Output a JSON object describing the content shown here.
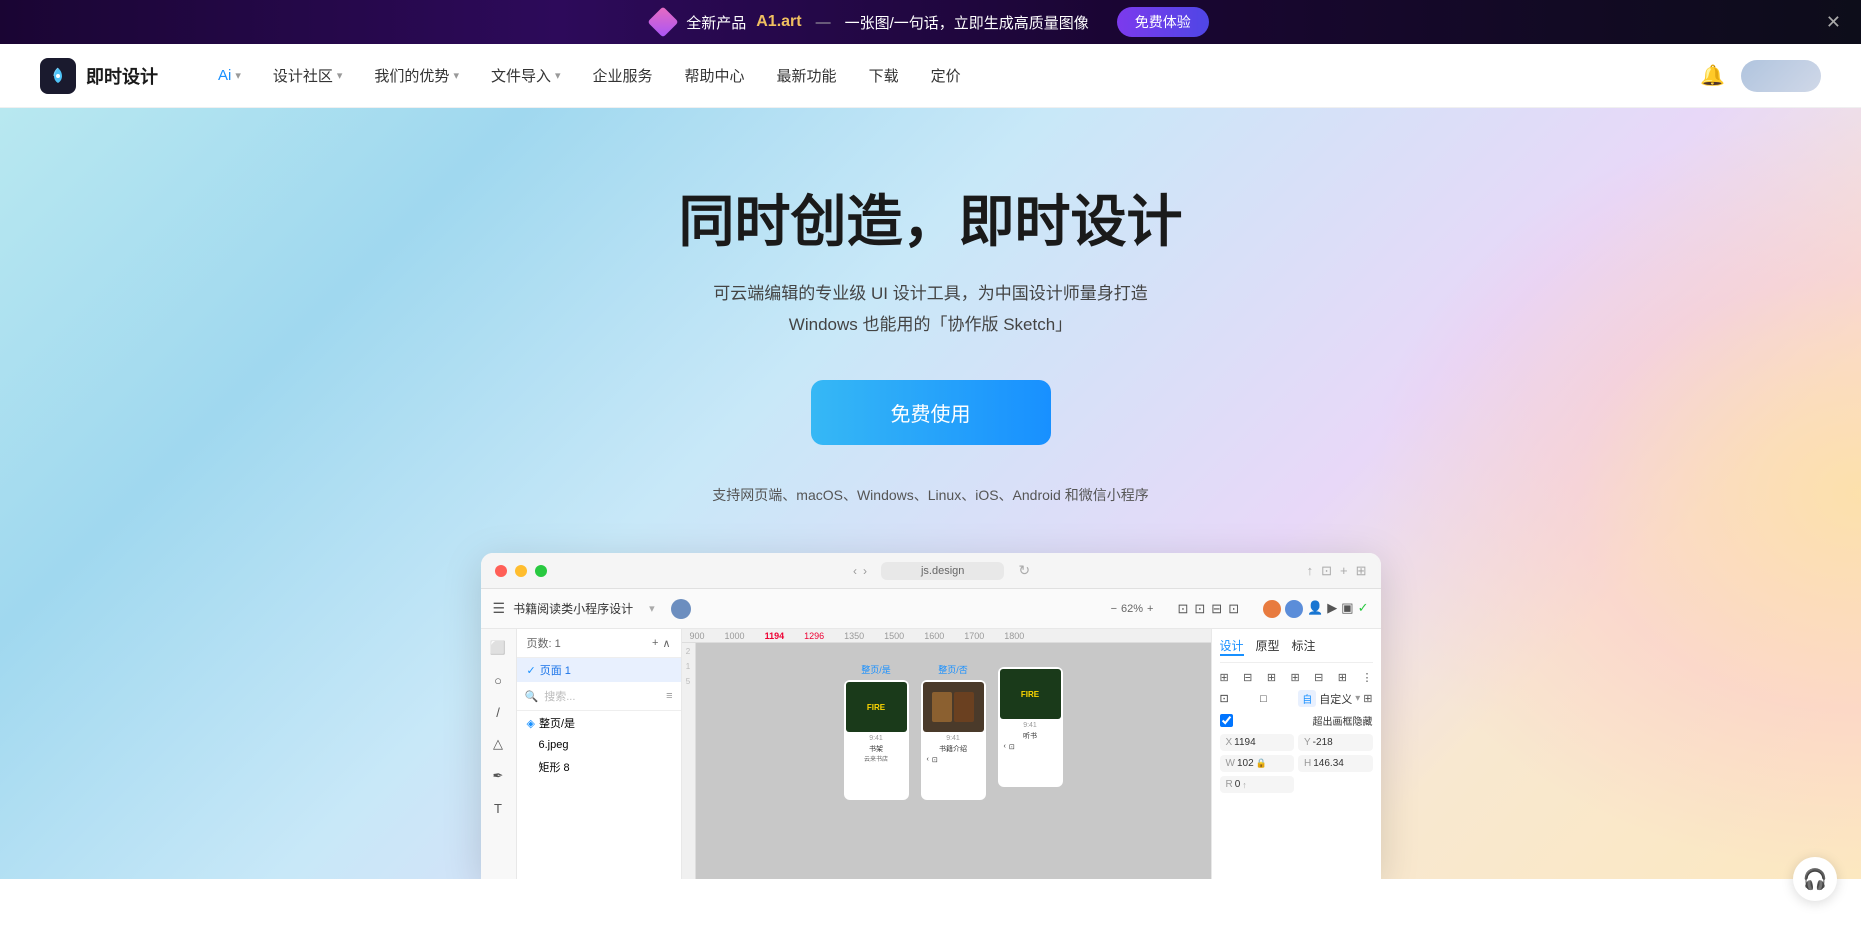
{
  "banner": {
    "diamond_label": "◆",
    "new_product": "全新产品",
    "brand": "A1.art",
    "separator": "—",
    "tagline": "一张图/一句话，立即生成高质量图像",
    "cta": "免费体验",
    "close": "✕"
  },
  "nav": {
    "logo_icon": "◈",
    "logo_text": "即时设计",
    "items": [
      {
        "label": "Ai",
        "has_dropdown": true,
        "active": true
      },
      {
        "label": "设计社区",
        "has_dropdown": true,
        "active": false
      },
      {
        "label": "我们的优势",
        "has_dropdown": true,
        "active": false
      },
      {
        "label": "文件导入",
        "has_dropdown": true,
        "active": false
      },
      {
        "label": "企业服务",
        "has_dropdown": false,
        "active": false
      },
      {
        "label": "帮助中心",
        "has_dropdown": false,
        "active": false
      },
      {
        "label": "最新功能",
        "has_dropdown": false,
        "active": false
      },
      {
        "label": "下载",
        "has_dropdown": false,
        "active": false
      },
      {
        "label": "定价",
        "has_dropdown": false,
        "active": false
      }
    ],
    "bell": "🔔"
  },
  "hero": {
    "title": "同时创造，即时设计",
    "subtitle_line1": "可云端编辑的专业级 UI 设计工具，为中国设计师量身打造",
    "subtitle_line2": "Windows 也能用的「协作版 Sketch」",
    "cta_button": "免费使用",
    "platforms": "支持网页端、macOS、Windows、Linux、iOS、Android 和微信小程序"
  },
  "app_window": {
    "title": "书籍阅读类小程序设计",
    "url": "js.design",
    "zoom": "62%",
    "pages_label": "页数: 1",
    "page_name": "页面 1",
    "canvas_rulers": [
      "900",
      "1000",
      "1194",
      "1296",
      "1350",
      "1500",
      "1600",
      "1700",
      "1800"
    ],
    "layers": [
      {
        "name": "整页/是",
        "indent": 0
      },
      {
        "name": "6.jpeg",
        "indent": 1
      },
      {
        "name": "矩形 8",
        "indent": 1
      }
    ],
    "right_panel": {
      "tabs": [
        "设计",
        "原型",
        "标注"
      ],
      "active_tab": "设计",
      "x": "1194",
      "y": "-218",
      "w": "102",
      "h": "146.34",
      "r": "0",
      "custom_label": "自定义",
      "overflow_label": "超出画框隐藏",
      "coords_x": "X",
      "coords_y": "Y",
      "coords_w": "W",
      "coords_h": "H",
      "coords_r": "R"
    },
    "frames": [
      {
        "label": "整页/是",
        "type": "fire"
      },
      {
        "label": "整页/否",
        "type": "group"
      },
      {
        "label": "",
        "type": "fire2"
      }
    ]
  },
  "headset_icon": "🎧",
  "colors": {
    "accent_blue": "#1890ff",
    "hero_bg_start": "#b8e8f0",
    "hero_bg_end": "#fce8c0",
    "banner_bg": "#1a0533"
  }
}
